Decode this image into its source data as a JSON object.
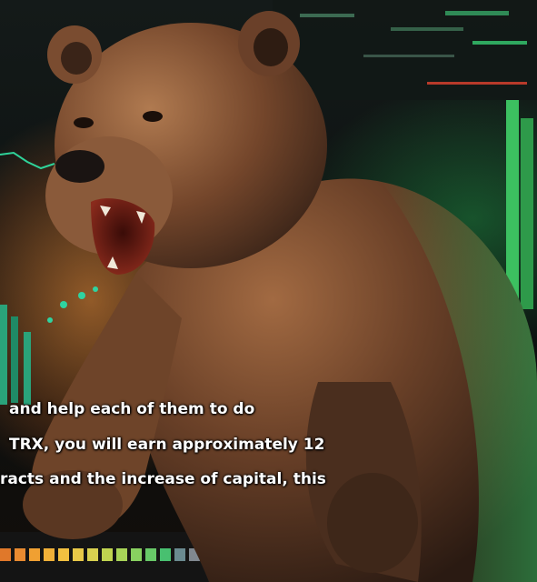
{
  "scene": {
    "subject": "bear-icon",
    "background": "stock-chart-icon",
    "colors": {
      "bear_fur": "#7a4a2c",
      "glow_warm": "#ff9640",
      "glow_green": "#2fd36a",
      "background": "#0c1110"
    }
  },
  "caption": {
    "line_1": "and help each of them to do",
    "line_2": "TRX, you will earn approximately 12",
    "line_3": "racts and the increase of capital, this"
  }
}
